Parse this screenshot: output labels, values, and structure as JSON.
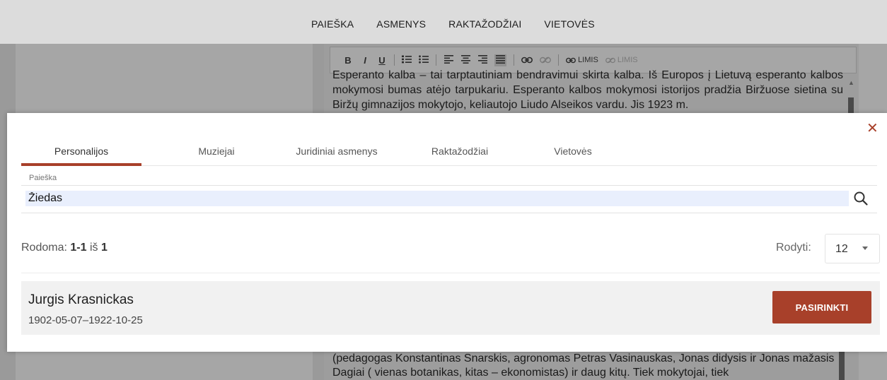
{
  "nav": {
    "items": [
      "PAIEŠKA",
      "ASMENYS",
      "RAKTAŽODŽIAI",
      "VIETOVĖS"
    ]
  },
  "editor": {
    "toolbar": {
      "bold": "B",
      "italic": "I",
      "underline": "U",
      "ordered_list": "⅓",
      "unordered_list": "☰",
      "limis": "LIMIS",
      "unlimis": "LIMIS"
    },
    "text_top": "Esperanto kalba – tai tarptautiniam bendravimui skirta kalba. Iš Europos į Lietuvą esperanto kalbos mokymosi bumas atėjo tarpukariu. Esperanto kalbos mokymosi istorijos pradžia Biržuose sietina su Biržų gimnazijos mokytojo, keliautojo Liudo Alseikos vardu. Jis 1923 m.",
    "text_bottom": "(pedagogas Konstantinas Snarskis, agronomas Petras Vasinauskas, Jonas didysis ir Jonas mažasis Dagiai ( vienas botanikas, kitas – ekonomistas) ir daug kitų. Tiek mokytojai, tiek"
  },
  "modal": {
    "close_glyph": "✕",
    "tabs": [
      {
        "label": "Personalijos",
        "active": true
      },
      {
        "label": "Muziejai",
        "active": false
      },
      {
        "label": "Juridiniai asmenys",
        "active": false
      },
      {
        "label": "Raktažodžiai",
        "active": false
      },
      {
        "label": "Vietovės",
        "active": false
      }
    ],
    "search": {
      "label": "Paieška",
      "value": "Žiedas"
    },
    "results": {
      "prefix": "Rodoma:",
      "range": "1-1",
      "of_word": "iš",
      "total": "1"
    },
    "per_page": {
      "label": "Rodyti:",
      "value": "12"
    },
    "items": [
      {
        "name": "Jurgis Krasnickas",
        "dates": "1902-05-07–1922-10-25",
        "button_label": "PASIRINKTI"
      }
    ]
  },
  "colors": {
    "accent": "#a8402a",
    "search_bg": "#e9effd"
  }
}
